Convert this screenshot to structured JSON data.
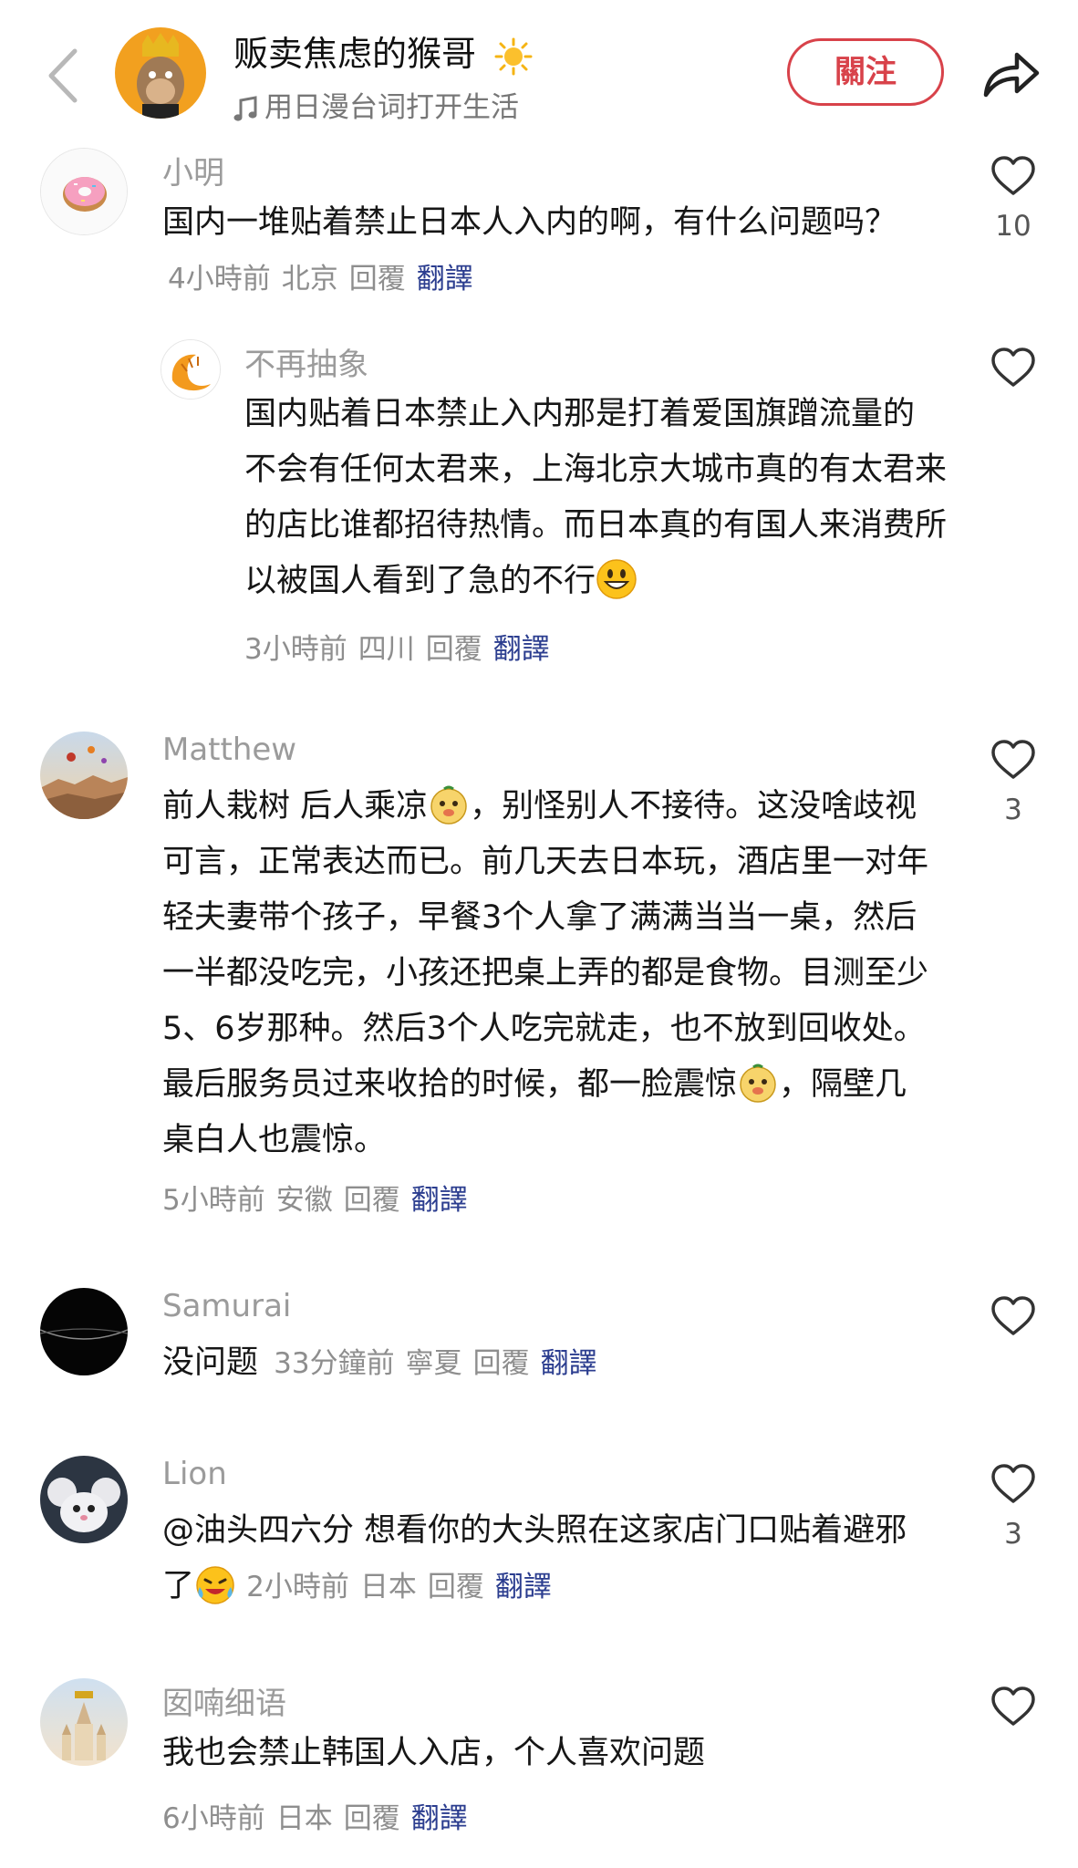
{
  "header": {
    "channel_name": "贩卖焦虑的猴哥",
    "subtitle": "用日漫台词打开生活",
    "follow_label": "關注"
  },
  "comments": [
    {
      "username": "小明",
      "text": "国内一堆贴着禁止日本人入内的啊，有什么问题吗？",
      "time": "4小時前",
      "location": "北京",
      "reply": "回覆",
      "translate": "翻譯",
      "likes": "10"
    },
    {
      "username": "不再抽象",
      "text": "国内贴着日本禁止入内那是打着爱国旗蹭流量的 不会有任何太君来，上海北京大城市真的有太君来的店比谁都招待热情。而日本真的有国人来消费所以被国人看到了急的不行",
      "time": "3小時前",
      "location": "四川",
      "reply": "回覆",
      "translate": "翻譯",
      "likes": ""
    },
    {
      "username": "Matthew",
      "text_a": "前人栽树 后人乘凉",
      "text_b": "，别怪别人不接待。这没啥歧视可言，正常表达而已。前几天去日本玩，酒店里一对年轻夫妻带个孩子，早餐3个人拿了满满当当一桌，然后一半都没吃完，小孩还把桌上弄的都是食物。目测至少5、6岁那种。然后3个人吃完就走，也不放到回收处。最后服务员过来收拾的时候，都一脸震惊",
      "text_c": "，隔壁几桌白人也震惊。",
      "time": "5小時前",
      "location": "安徽",
      "reply": "回覆",
      "translate": "翻譯",
      "likes": "3"
    },
    {
      "username": "Samurai",
      "text": "没问题",
      "time": "33分鐘前",
      "location": "寧夏",
      "reply": "回覆",
      "translate": "翻譯",
      "likes": ""
    },
    {
      "username": "Lion",
      "text": "@油头四六分  想看你的大头照在这家店门口贴着避邪了",
      "time": "2小時前",
      "location": "日本",
      "reply": "回覆",
      "translate": "翻譯",
      "likes": "3"
    },
    {
      "username": "囡喃细语",
      "text": "我也会禁止韩国人入店，个人喜欢问题",
      "time": "6小時前",
      "location": "日本",
      "reply": "回覆",
      "translate": "翻譯",
      "likes": ""
    }
  ],
  "colors": {
    "accent": "#d8424a",
    "translate": "#2b3d8f",
    "muted": "#8e8e8e"
  },
  "icons": [
    "back-chevron-icon",
    "sun-emoji-icon",
    "music-note-icon",
    "share-arrow-icon",
    "heart-icon",
    "doughnut-avatar",
    "croissant-avatar",
    "face-emoji-icon",
    "crying-laugh-emoji-icon"
  ]
}
